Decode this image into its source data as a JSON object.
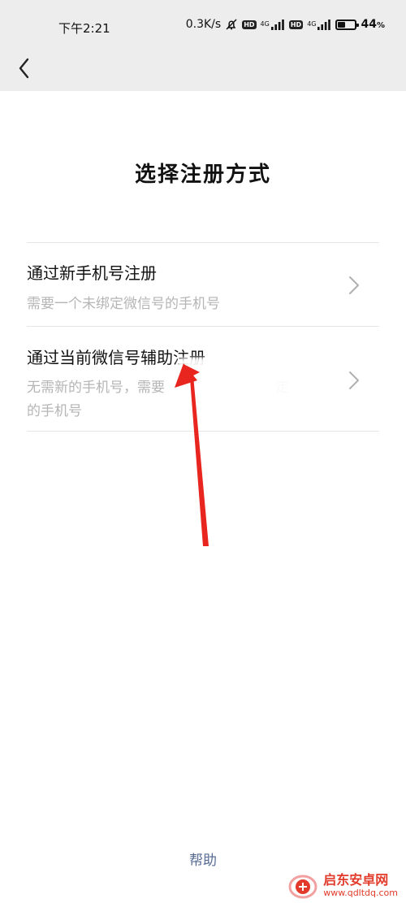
{
  "status_bar": {
    "time": "下午2:21",
    "net_speed": "0.3K/s",
    "network_1": "4G",
    "network_2": "4G",
    "hd_1": "HD",
    "hd_2": "HD",
    "battery_percent": "44",
    "battery_unit": "%",
    "battery_level": 0.44
  },
  "header": {
    "back_icon": "chevron-left-icon"
  },
  "page": {
    "title": "选择注册方式"
  },
  "options": [
    {
      "title": "通过新手机号注册",
      "description": "需要一个未绑定微信号的手机号",
      "icon": "chevron-right-icon"
    },
    {
      "title": "通过当前微信号辅助注册",
      "description_line1": "无需新的手机号，需要",
      "description_line1_tail": "定",
      "description_line2": "的手机号",
      "icon": "chevron-right-icon"
    }
  ],
  "footer": {
    "help_label": "帮助"
  },
  "watermark": {
    "name": "启东安卓网",
    "url": "www.qdltdq.com"
  },
  "colors": {
    "link": "#576b95",
    "annotation_arrow": "#e8261f",
    "header_bg": "#ededed"
  }
}
